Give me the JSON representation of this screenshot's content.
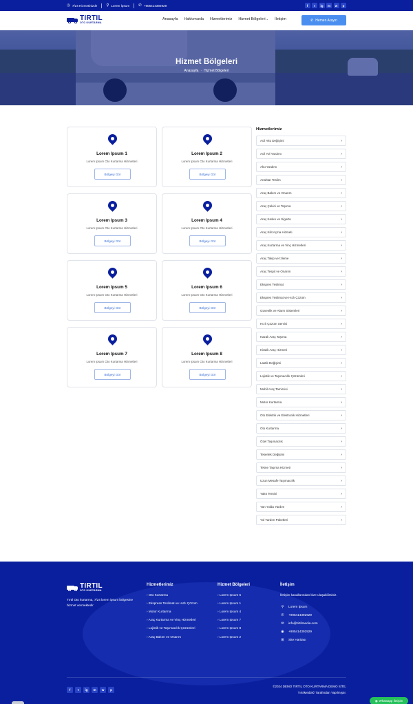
{
  "topbar": {
    "hours": "7/24 Hizmetinizde",
    "location": "Lorem İpsum",
    "phone": "+905414392929",
    "social": [
      "f",
      "t",
      "ig",
      "m",
      "w",
      "p"
    ]
  },
  "brand": {
    "name": "TIRTIL",
    "tagline": "OTO KURTARMA"
  },
  "nav": {
    "items": [
      "Anasayfa",
      "Hakkımızda",
      "Hizmetlerimiz",
      "Hizmet Bölgeleri",
      "İletişim"
    ],
    "dropdown_marker": "⌄",
    "call_button": "Hemen Arayın"
  },
  "hero": {
    "title": "Hizmet Bölgeleri",
    "breadcrumb_home": "Anasayfa",
    "breadcrumb_current": "Hizmet Bölgeleri"
  },
  "regions": [
    {
      "title": "Lorem Ipsum 1",
      "desc": "Lorem Ipsum Oto Kurtarma Hizmetleri",
      "button": "Bölgeyi Gör"
    },
    {
      "title": "Lorem Ipsum 2",
      "desc": "Lorem Ipsum Oto Kurtarma Hizmetleri",
      "button": "Bölgeyi Gör"
    },
    {
      "title": "Lorem Ipsum 3",
      "desc": "Lorem Ipsum Oto Kurtarma Hizmetleri",
      "button": "Bölgeyi Gör"
    },
    {
      "title": "Lorem Ipsum 4",
      "desc": "Lorem Ipsum Oto Kurtarma Hizmetleri",
      "button": "Bölgeyi Gör"
    },
    {
      "title": "Lorem Ipsum 5",
      "desc": "Lorem Ipsum Oto Kurtarma Hizmetleri",
      "button": "Bölgeyi Gör"
    },
    {
      "title": "Lorem Ipsum 6",
      "desc": "Lorem Ipsum Oto Kurtarma Hizmetleri",
      "button": "Bölgeyi Gör"
    },
    {
      "title": "Lorem Ipsum 7",
      "desc": "Lorem Ipsum Oto Kurtarma Hizmetleri",
      "button": "Bölgeyi Gör"
    },
    {
      "title": "Lorem Ipsum 8",
      "desc": "Lorem Ipsum Oto Kurtarma Hizmetleri",
      "button": "Bölgeyi Gör"
    }
  ],
  "sidebar": {
    "title": "Hizmetlerimiz",
    "items": [
      "Acil Akü Değişimi",
      "Acil Yol Yardımı",
      "Akü Yardımı",
      "Anahtar Teslim",
      "Araç Bakım ve Onarım",
      "Araç Çekici ve Taşıma",
      "Araç Kasko ve Sigorta",
      "Araç Kilit Açma Hizmeti",
      "Araç Kurtarma ve Vinç Hizmetleri",
      "Araç Takip ve İzleme",
      "Araç Tespit ve Onarım",
      "Ekspres Teslimat",
      "Ekspres Teslimat ve Hızlı Çözüm",
      "Güvenlik ve Alarm Sistemleri",
      "Hızlı Çözüm Servisi",
      "Kazalı Araç Taşıma",
      "Kiralık Araç Hizmeti",
      "Lastik Değişimi",
      "Lojistik ve Taşımacılık Çözümleri",
      "Mobil Araç Tamircisi",
      "Motor Kurtarma",
      "Oto Elektrik ve Elektronik Hizmetleri",
      "Oto Kurtarma",
      "Özel Taşımacılık",
      "Tekerlek Değişimi",
      "Tekne Taşıma Hizmeti",
      "Uzun Mesafe Taşımacılık",
      "Yakıt Temini",
      "Yan Yolda Yardım",
      "Yol Yardım Paketleri"
    ]
  },
  "footer": {
    "about": "Tırtıl Oto kurtarma, 7/24 lorem ipsum bölgesine hizmet vermektedir",
    "services_title": "Hizmetlerimiz",
    "services": [
      "Oto Kurtarma",
      "Ekspress Teslimat ve Hızlı Çözüm",
      "Motor Kurtarma",
      "Araç Kurtarma ve Vinç Hizmetleri",
      "Lojistik ve Taşımacılık Çözümleri",
      "Araç Bakım ve Onarım"
    ],
    "regions_title": "Hizmet Bölgeleri",
    "regions": [
      "Lorem Ipsum 6",
      "Lorem Ipsum 1",
      "Lorem Ipsum 4",
      "Lorem Ipsum 7",
      "Lorem Ipsum 8",
      "Lorem Ipsum 2"
    ],
    "contact_title": "İletişim",
    "contact_intro": "İletişim kanallarından bize ulaşabilirsiniz.",
    "contact": {
      "address": "Lorem İpsum",
      "phone": "+905414392929",
      "email": "info@tirtilmedia.com",
      "whatsapp": "+905414392929",
      "sitemap": "Site Haritası"
    },
    "copyright_line1": "©2024 DEMO TIRTIL OTO KURTARMA DEMO SİTE,",
    "copyright_line2": "TırtılMedia© Tarafından Yapılmıştır.",
    "social": [
      "f",
      "t",
      "ig",
      "m",
      "w",
      "p"
    ]
  },
  "whatsapp_button": "Whatsapp İletişim",
  "icons": {
    "clock": "clock-icon",
    "location": "map-pin-icon",
    "phone": "phone-icon",
    "email": "mail-icon",
    "whatsapp": "whatsapp-icon",
    "sitemap": "sitemap-icon",
    "arrow": "chevron-right-icon",
    "pin": "location-pin-icon"
  },
  "colors": {
    "primary": "#0a1f9e",
    "accent": "#4a8ff0",
    "button_border": "#9fb7e6",
    "whatsapp": "#25c15a"
  }
}
